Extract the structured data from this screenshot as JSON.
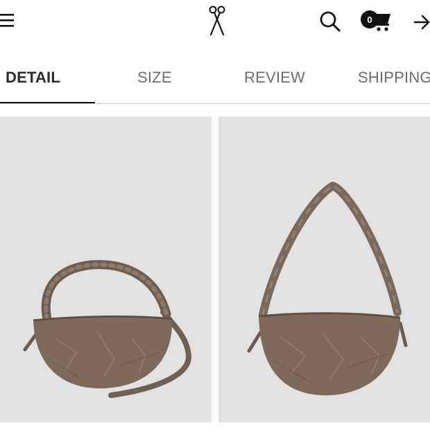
{
  "header": {
    "menu_icon": "hamburger-menu-icon",
    "logo_icon": "scissors-logo-icon",
    "search_icon": "search-icon",
    "cart": {
      "icon": "shopping-cart-icon",
      "count": "0"
    },
    "login_icon": "arrow-right-login-icon"
  },
  "tabs": [
    {
      "label": "DETAIL",
      "active": true
    },
    {
      "label": "SIZE",
      "active": false
    },
    {
      "label": "REVIEW",
      "active": false
    },
    {
      "label": "SHIPPING",
      "active": false
    }
  ],
  "colors": {
    "photo_background": "#e2e2e2",
    "bag_leather": "#7d6a5c",
    "active_tab": "#2b2b2b",
    "inactive_tab": "#6c6c6c"
  }
}
